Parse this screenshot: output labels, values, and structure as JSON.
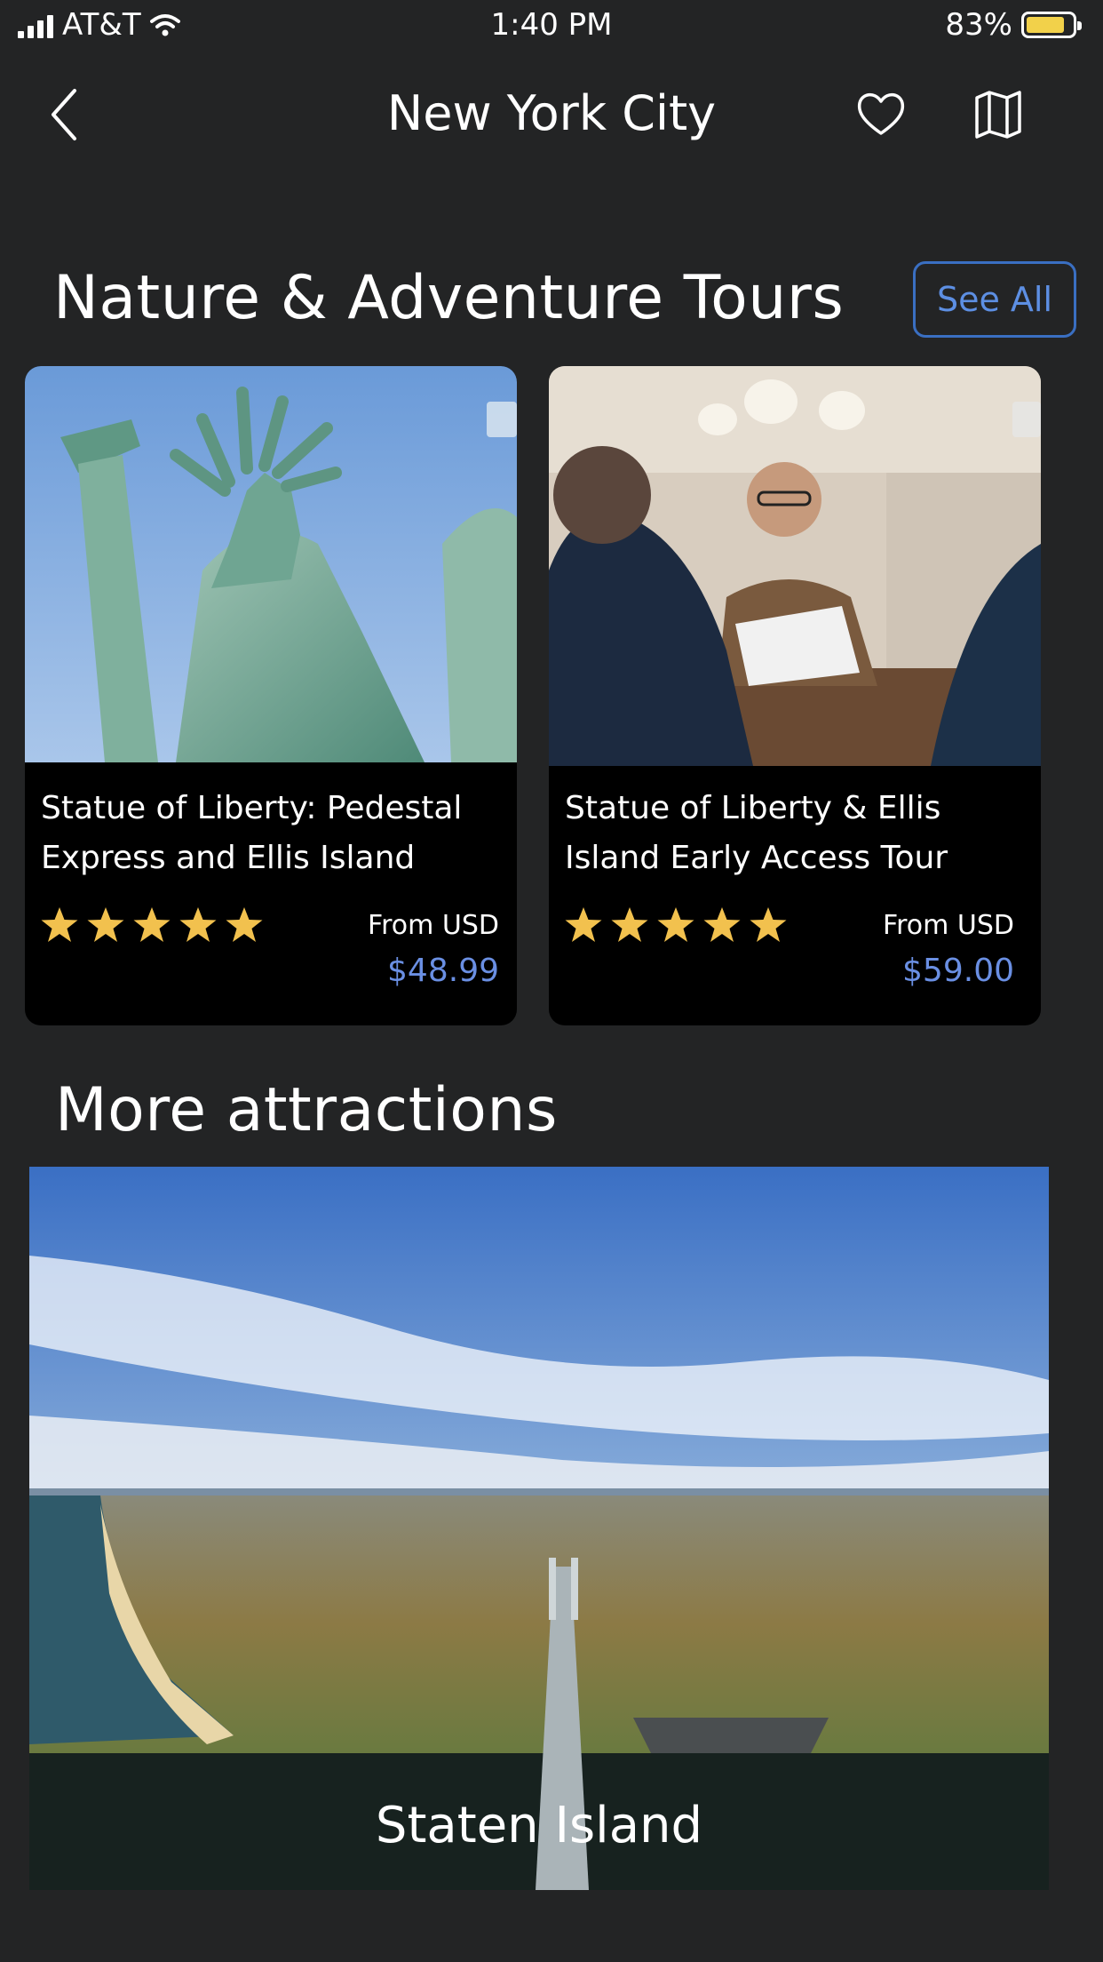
{
  "status_bar": {
    "carrier": "AT&T",
    "time": "1:40 PM",
    "battery": "83%",
    "battery_level": 0.83
  },
  "nav": {
    "title": "New York City",
    "icons": [
      "back-chevron-icon",
      "heart-icon",
      "map-icon"
    ]
  },
  "sections": {
    "tours": {
      "title": "Nature & Adventure Tours",
      "see_all": "See All"
    },
    "more": {
      "title": "More attractions"
    }
  },
  "cards": [
    {
      "title_line1": "Statue of Liberty: Pedestal",
      "title_line2": "Express and Ellis Island",
      "rating": 5,
      "from_label": "From USD",
      "price": "$48.99"
    },
    {
      "title_line1": "Statue of Liberty & Ellis",
      "title_line2": "Island Early Access Tour",
      "rating": 5,
      "from_label": "From USD",
      "price": "$59.00"
    }
  ],
  "attraction": {
    "name": "Staten Island"
  },
  "colors": {
    "background": "#232425",
    "card": "#000000",
    "accent_blue": "#5d8fe3",
    "star": "#f2c14e"
  }
}
